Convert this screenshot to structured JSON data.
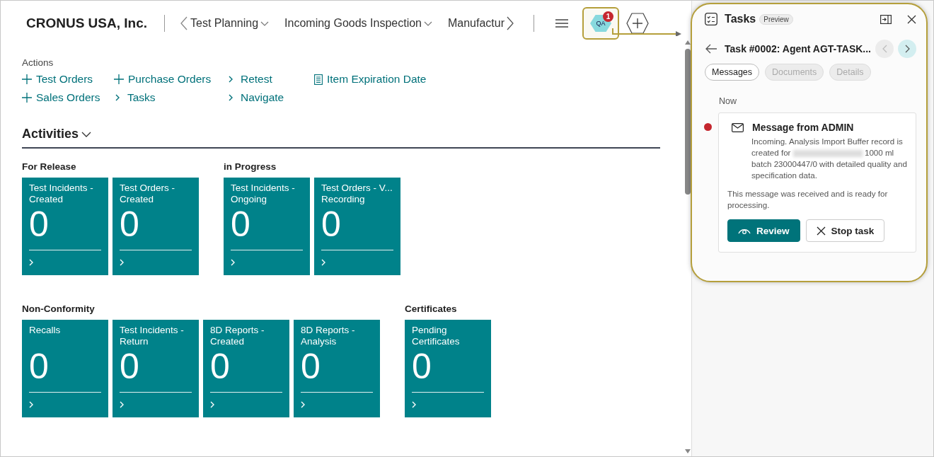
{
  "header": {
    "company": "CRONUS USA, Inc.",
    "nav_items": [
      {
        "label": "Test Planning",
        "has_menu": true
      },
      {
        "label": "Incoming Goods Inspection",
        "has_menu": true
      },
      {
        "label": "Manufactur",
        "has_menu": false
      }
    ],
    "agent_badge": {
      "label": "QA",
      "count": "1",
      "highlighted": true
    }
  },
  "actions": {
    "title": "Actions",
    "items": [
      {
        "kind": "new",
        "label": "Test Orders"
      },
      {
        "kind": "new",
        "label": "Purchase Orders"
      },
      {
        "kind": "nav",
        "label": "Retest"
      },
      {
        "kind": "report",
        "label": "Item Expiration Date"
      },
      {
        "kind": "new",
        "label": "Sales Orders"
      },
      {
        "kind": "nav",
        "label": "Tasks"
      },
      {
        "kind": "nav",
        "label": "Navigate"
      }
    ]
  },
  "activities": {
    "title": "Activities",
    "groups": [
      {
        "title": "For Release",
        "tiles": [
          {
            "label": "Test Incidents - Created",
            "value": "0"
          },
          {
            "label": "Test Orders - Created",
            "value": "0"
          }
        ]
      },
      {
        "title": "in Progress",
        "tiles": [
          {
            "label": "Test Incidents - Ongoing",
            "value": "0"
          },
          {
            "label": "Test Orders - V... Recording",
            "value": "0"
          }
        ]
      },
      {
        "title": "Non-Conformity",
        "tiles": [
          {
            "label": "Recalls",
            "value": "0"
          },
          {
            "label": "Test Incidents - Return",
            "value": "0"
          },
          {
            "label": "8D Reports - Created",
            "value": "0"
          },
          {
            "label": "8D Reports - Analysis",
            "value": "0"
          }
        ]
      },
      {
        "title": "Certificates",
        "tiles": [
          {
            "label": "Pending Certificates",
            "value": "0"
          }
        ]
      }
    ]
  },
  "tasks_panel": {
    "title": "Tasks",
    "badge": "Preview",
    "task_title": "Task #0002: Agent AGT-TASK...",
    "highlighted": true,
    "tabs": [
      {
        "label": "Messages",
        "selected": true
      },
      {
        "label": "Documents",
        "selected": false
      },
      {
        "label": "Details",
        "selected": false
      }
    ],
    "time": "Now",
    "message": {
      "unread": true,
      "title": "Message from ADMIN",
      "body_before": "Incoming. Analysis Import Buffer record is created for",
      "body_after": "1000 ml batch 23000447/0 with detailed quality and specification data.",
      "status": "This message was received and is ready for processing.",
      "buttons": [
        {
          "kind": "review",
          "label": "Review"
        },
        {
          "kind": "stop",
          "label": "Stop task"
        }
      ]
    }
  }
}
